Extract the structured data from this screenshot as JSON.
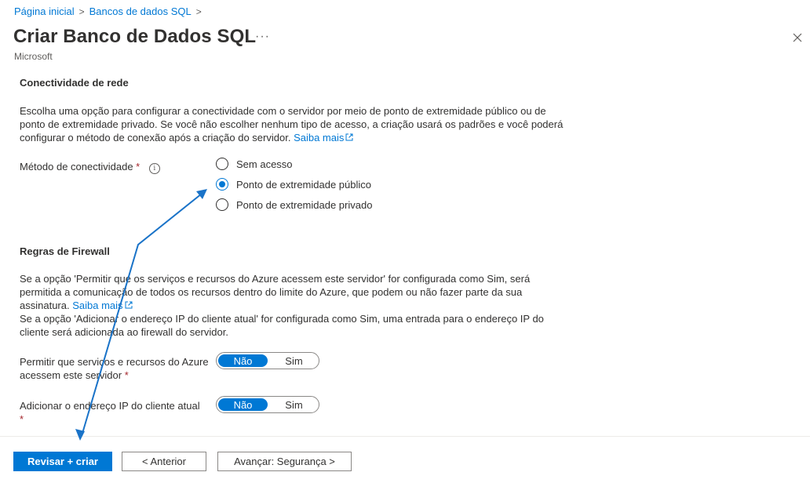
{
  "breadcrumb": {
    "home": "Página inicial",
    "sql_databases": "Bancos de dados SQL"
  },
  "header": {
    "title": "Criar Banco de Dados SQL",
    "more": "···",
    "publisher": "Microsoft"
  },
  "network": {
    "heading": "Conectividade de rede",
    "description": "Escolha uma opção para configurar a conectividade com o servidor por meio de ponto de extremidade público ou de ponto de extremidade privado. Se você não escolher nenhum tipo de acesso, a criação usará os padrões e você poderá configurar o método de conexão após a criação do servidor.",
    "learn_more": "Saiba mais",
    "method_label": "Método de conectividade",
    "required_mark": "*",
    "info_glyph": "i",
    "options": [
      {
        "label": "Sem acesso",
        "selected": false
      },
      {
        "label": "Ponto de extremidade público",
        "selected": true
      },
      {
        "label": "Ponto de extremidade privado",
        "selected": false
      }
    ]
  },
  "firewall": {
    "heading": "Regras de Firewall",
    "description1": "Se a opção 'Permitir que os serviços e recursos do Azure acessem este servidor' for configurada como Sim, será permitida a comunicação de todos os recursos dentro do limite do Azure, que podem ou não fazer parte da sua assinatura.",
    "learn_more": "Saiba mais",
    "description2": "Se a opção 'Adicionar o endereço IP do cliente atual' for configurada como Sim, uma entrada para o endereço IP do cliente será adicionada ao firewall do servidor.",
    "allow_azure": {
      "label": "Permitir que serviços e recursos do Azure acessem este servidor",
      "required_mark": "*",
      "off": "Não",
      "on": "Sim",
      "value": "Não"
    },
    "add_client_ip": {
      "label": "Adicionar o endereço IP do cliente atual",
      "required_mark": "*",
      "off": "Não",
      "on": "Sim",
      "value": "Não"
    }
  },
  "footer": {
    "review_create": "Revisar + criar",
    "previous": "< Anterior",
    "next": "Avançar: Segurança >"
  },
  "colors": {
    "accent": "#0078d4",
    "required": "#a4262c",
    "text": "#323130",
    "annotation_arrow": "#1a73c8"
  },
  "icons": [
    "chevron-right-icon",
    "close-icon",
    "external-link-icon",
    "info-icon"
  ]
}
